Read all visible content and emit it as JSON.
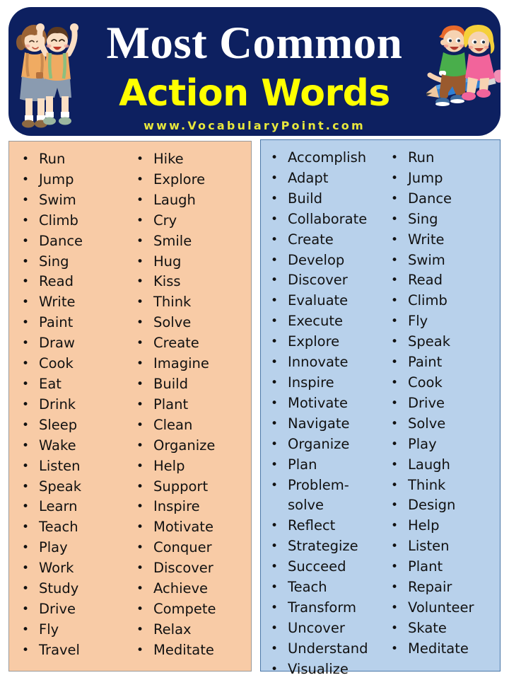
{
  "header": {
    "title": "Most Common",
    "subtitle": "Action Words",
    "url": "www.VocabularyPoint.com",
    "background_color": "#0d2060",
    "title_color": "#ffffff",
    "subtitle_color": "#ffff00",
    "url_color": "#e8e83c",
    "illustrations": [
      {
        "name": "two-kids-standing-illustration",
        "side": "left"
      },
      {
        "name": "two-kids-riding-pencil-illustration",
        "side": "right"
      }
    ]
  },
  "boxes": [
    {
      "id": "left",
      "background_color": "#f8cba6",
      "border_color": "#9a9a9a",
      "columns": [
        {
          "items": [
            "Run",
            "Jump",
            "Swim",
            "Climb",
            "Dance",
            "Sing",
            "Read",
            "Write",
            "Paint",
            "Draw",
            "Cook",
            "Eat",
            "Drink",
            "Sleep",
            "Wake",
            "Listen",
            "Speak",
            "Learn",
            "Teach",
            "Play",
            "Work",
            "Study",
            "Drive",
            "Fly",
            "Travel"
          ]
        },
        {
          "items": [
            "Hike",
            "Explore",
            "Laugh",
            "Cry",
            "Smile",
            "Hug",
            "Kiss",
            "Think",
            "Solve",
            "Create",
            "Imagine",
            "Build",
            "Plant",
            "Clean",
            "Organize",
            "Help",
            "Support",
            "Inspire",
            "Motivate",
            "Conquer",
            "Discover",
            "Achieve",
            "Compete",
            "Relax",
            "Meditate"
          ]
        }
      ]
    },
    {
      "id": "right",
      "background_color": "#b8d1eb",
      "border_color": "#4a77a8",
      "columns": [
        {
          "items": [
            "Accomplish",
            "Adapt",
            "Build",
            "Collaborate",
            "Create",
            "Develop",
            "Discover",
            "Evaluate",
            "Execute",
            "Explore",
            "Innovate",
            "Inspire",
            "Motivate",
            "Navigate",
            "Organize",
            "Plan",
            "Problem-solve",
            "Reflect",
            "Strategize",
            "Succeed",
            "Teach",
            "Transform",
            "Uncover",
            "Understand",
            "Visualize"
          ]
        },
        {
          "items": [
            "Run",
            "Jump",
            "Dance",
            "Sing",
            "Write",
            "Swim",
            "Read",
            "Climb",
            "Fly",
            "Speak",
            "Paint",
            "Cook",
            "Drive",
            "Solve",
            "Play",
            "Laugh",
            "Think",
            "Design",
            "Help",
            "Listen",
            "Plant",
            "Repair",
            "Volunteer",
            "Skate",
            "Meditate"
          ]
        }
      ]
    }
  ],
  "bullet_glyph": "•"
}
